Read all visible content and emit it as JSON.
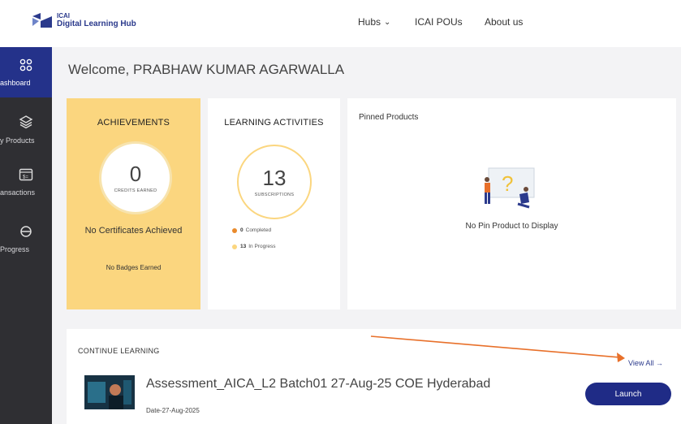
{
  "header": {
    "logo_small": "ICAI",
    "logo_big": "Digital Learning Hub",
    "nav": [
      {
        "label": "Hubs"
      },
      {
        "label": "ICAI POUs"
      },
      {
        "label": "About us"
      }
    ]
  },
  "sidebar": {
    "items": [
      {
        "label": "ashboard",
        "icon": "dashboard-icon",
        "active": true
      },
      {
        "label": "y Products",
        "icon": "layers-icon"
      },
      {
        "label": "ansactions",
        "icon": "transactions-icon"
      },
      {
        "label": "Progress",
        "icon": "globe-icon"
      }
    ]
  },
  "welcome": {
    "prefix": "Welcome, ",
    "name": "PRABHAW KUMAR AGARWALLA"
  },
  "achievements": {
    "title": "ACHIEVEMENTS",
    "credits": "0",
    "credits_label": "CREDITS EARNED",
    "certificates": "No Certificates Achieved",
    "badges": "No Badges Earned"
  },
  "activities": {
    "title": "LEARNING ACTIVITIES",
    "count": "13",
    "count_label": "SUBSCRIPTIONS",
    "completed_value": "0",
    "completed_label": "Completed",
    "in_progress_value": "13",
    "in_progress_label": "In Progress"
  },
  "pinned": {
    "title": "Pinned Products",
    "empty": "No Pin Product to Display"
  },
  "continue": {
    "title": "CONTINUE LEARNING",
    "view_all": "View All →",
    "course_title": "Assessment_AICA_L2 Batch01 27-Aug-25 COE Hyderabad",
    "course_date": "Date-27-Aug-2025",
    "launch": "Launch"
  },
  "colors": {
    "accent": "#24328a",
    "achievements_bg": "#fbd67f",
    "sidebar_bg": "#2f2f33",
    "completed_dot": "#e98a2c",
    "in_progress_dot": "#fbd67f",
    "annotation_arrow": "#e8702a"
  }
}
